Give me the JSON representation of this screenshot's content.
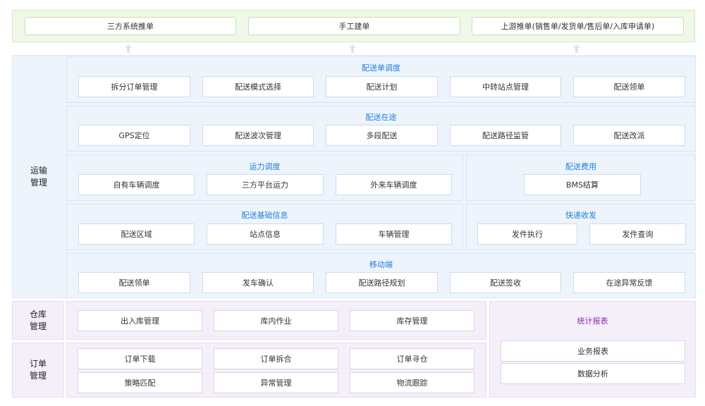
{
  "sources": [
    "三方系统推单",
    "手工建单",
    "上游推单(销售单/发货单/售后单/入库申请单)"
  ],
  "transport": {
    "label": "运输\n管理",
    "dispatch": {
      "title": "配送单调度",
      "items": [
        "拆分订单管理",
        "配送模式选择",
        "配送计划",
        "中转站点管理",
        "配送领单"
      ]
    },
    "in_transit": {
      "title": "配送在途",
      "items": [
        "GPS定位",
        "配送波次管理",
        "多段配送",
        "配送路径监管",
        "配送改派"
      ]
    },
    "capacity": {
      "title": "运力调度",
      "items": [
        "自有车辆调度",
        "三方平台运力",
        "外来车辆调度"
      ]
    },
    "fees": {
      "title": "配送费用",
      "items": [
        "BMS结算"
      ]
    },
    "basic_info": {
      "title": "配送基础信息",
      "items": [
        "配送区域",
        "站点信息",
        "车辆管理"
      ]
    },
    "express": {
      "title": "快递收发",
      "items": [
        "发件执行",
        "发件查询"
      ]
    },
    "mobile": {
      "title": "移动端",
      "items": [
        "配送领单",
        "发车确认",
        "配送路径规划",
        "配送签收",
        "在途异常反馈"
      ]
    }
  },
  "warehouse": {
    "label": "仓库\n管理",
    "items": [
      "出入库管理",
      "库内作业",
      "库存管理"
    ]
  },
  "order": {
    "label": "订单\n管理",
    "items": [
      "订单下载",
      "订单拆合",
      "订单寻仓",
      "策略匹配",
      "异常管理",
      "物流跟踪"
    ]
  },
  "stats": {
    "title": "统计报表",
    "items": [
      "业务报表",
      "数据分析"
    ]
  },
  "colors": {
    "title_blue": "#1f7ee0",
    "title_purple": "#8a2bb5",
    "green_bg": "#f0f8e7",
    "blue_bg": "#eef4fb",
    "purple_bg": "#f5effa"
  },
  "icons": [
    "arrow-up-icon"
  ]
}
